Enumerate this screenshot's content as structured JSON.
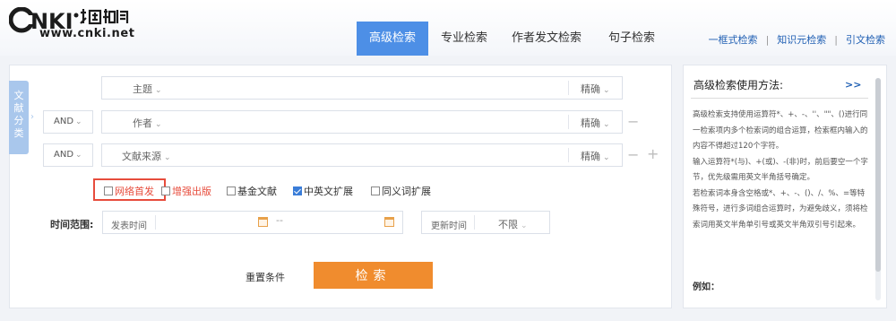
{
  "header": {
    "logo_url_text": "www.cnki.net",
    "tabs": [
      {
        "label": "高级检索",
        "active": true
      },
      {
        "label": "专业检索",
        "active": false
      },
      {
        "label": "作者发文检索",
        "active": false
      },
      {
        "label": "句子检索",
        "active": false
      }
    ],
    "links": [
      "一框式检索",
      "知识元检索",
      "引文检索"
    ]
  },
  "sidebar_tab": {
    "label": "文献分类"
  },
  "search_rows": [
    {
      "logic": "",
      "field": "主题",
      "match": "精确"
    },
    {
      "logic": "AND",
      "field": "作者",
      "match": "精确"
    },
    {
      "logic": "AND",
      "field": "文献来源",
      "match": "精确"
    }
  ],
  "options": [
    {
      "label": "网络首发",
      "checked": false,
      "color": "#e74c3c"
    },
    {
      "label": "增强出版",
      "checked": false,
      "color": "#e74c3c"
    },
    {
      "label": "基金文献",
      "checked": false,
      "color": "#333333"
    },
    {
      "label": "中英文扩展",
      "checked": true,
      "color": "#333333"
    },
    {
      "label": "同义词扩展",
      "checked": false,
      "color": "#333333"
    }
  ],
  "time": {
    "label": "时间范围:",
    "publish_label": "发表时间",
    "range_separator": "--",
    "update_label": "更新时间",
    "update_value": "不限"
  },
  "actions": {
    "reset": "重置条件",
    "search": "检索"
  },
  "help": {
    "title": "高级检索使用方法:",
    "more": ">>",
    "paragraphs": [
      "高级检索支持使用运算符*、+、-、''、\"\"、()进行同一检索项内多个检索词的组合运算，检索框内输入的内容不得超过120个字符。",
      "输入运算符*(与)、+(或)、-(非)时，前后要空一个字节，优先级需用英文半角括号确定。",
      "若检索词本身含空格或*、+、-、()、/、%、=等特殊符号，进行多词组合运算时，为避免歧义，须将检索词用英文半角单引号或英文半角双引号引起来。"
    ],
    "example_label": "例如："
  },
  "colors": {
    "accent": "#4d8fe6",
    "search_button": "#f08c2e",
    "highlight": "#e74c3c"
  }
}
